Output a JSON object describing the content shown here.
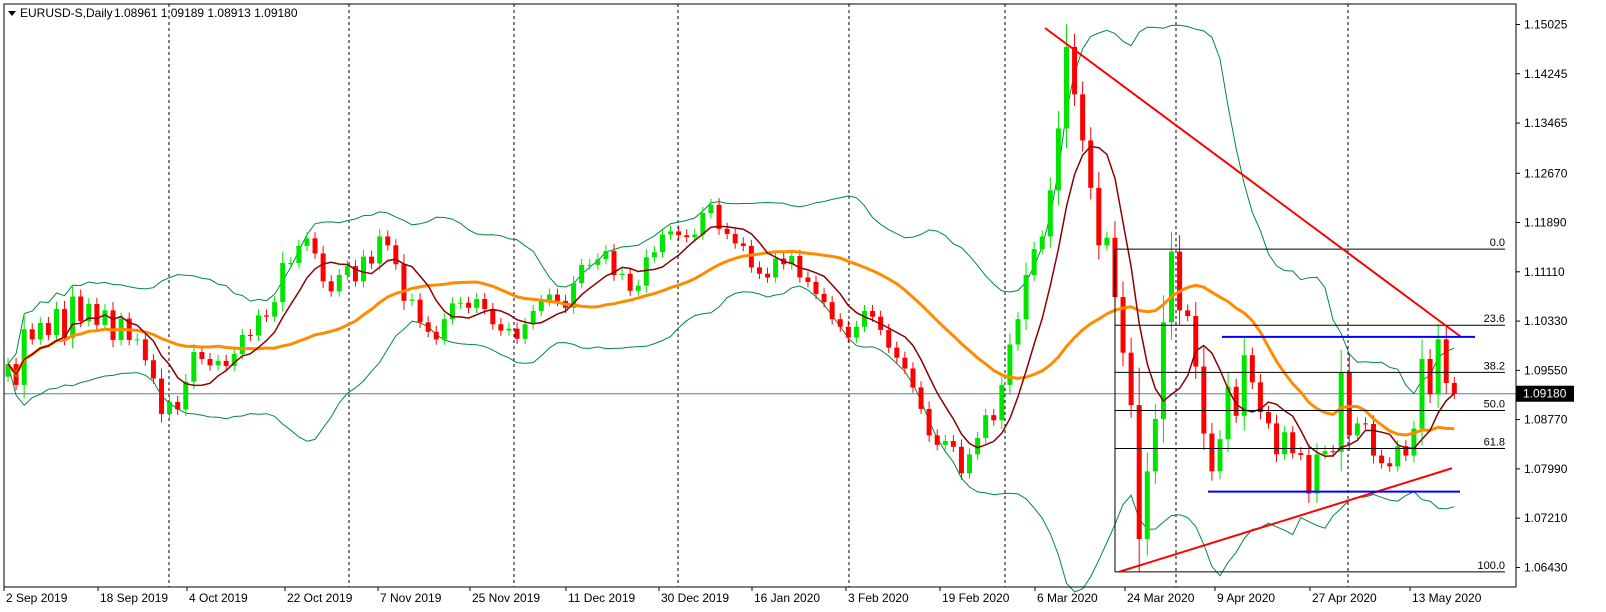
{
  "header": {
    "symbol": "EURUSD-S,Daily",
    "ohlc": "1.08961 1.09189 1.08913 1.09180"
  },
  "colors": {
    "background": "#ffffff",
    "bull": "#00e400",
    "bear": "#ff0000",
    "ma_fast": "#8b0000",
    "ma_slow": "#ff8c00",
    "bollinger": "#008a3e",
    "trendline": "#ff0000",
    "range_lines": "#0000ff",
    "fib_lines": "#000000",
    "price_line": "#4682b4",
    "current_price_bg": "#000000"
  },
  "chart_data": {
    "type": "candlestick",
    "symbol": "EURUSD-S",
    "timeframe": "Daily",
    "ylim": [
      1.0612,
      1.1535
    ],
    "y_ticks": [
      "1.15025",
      "1.14245",
      "1.13465",
      "1.12670",
      "1.11890",
      "1.11110",
      "1.10330",
      "1.09550",
      "1.08770",
      "1.07990",
      "1.07210",
      "1.06430"
    ],
    "x_ticks": [
      "2 Sep 2019",
      "18 Sep 2019",
      "4 Oct 2019",
      "22 Oct 2019",
      "7 Nov 2019",
      "25 Nov 2019",
      "11 Dec 2019",
      "30 Dec 2019",
      "16 Jan 2020",
      "3 Feb 2020",
      "19 Feb 2020",
      "6 Mar 2020",
      "24 Mar 2020",
      "9 Apr 2020",
      "27 Apr 2020",
      "13 May 2020"
    ],
    "current_price": "1.09180",
    "closes": [
      1.0965,
      1.0932,
      1.102,
      1.1004,
      1.103,
      1.1011,
      1.1052,
      1.1006,
      1.1072,
      1.1033,
      1.106,
      1.1027,
      1.105,
      1.1003,
      1.1037,
      1.1003,
      1.1004,
      1.0971,
      1.0942,
      1.0886,
      1.0905,
      1.0893,
      1.0937,
      1.0984,
      1.0973,
      1.0963,
      1.097,
      1.0962,
      1.0981,
      1.1011,
      1.101,
      1.1042,
      1.104,
      1.1063,
      1.1125,
      1.1125,
      1.1152,
      1.1164,
      1.114,
      1.1096,
      1.108,
      1.1106,
      1.112,
      1.1096,
      1.1135,
      1.1124,
      1.1167,
      1.1153,
      1.1123,
      1.1065,
      1.1067,
      1.1031,
      1.1016,
      1.1004,
      1.1036,
      1.1061,
      1.1062,
      1.1054,
      1.1068,
      1.1052,
      1.1028,
      1.1018,
      1.1021,
      1.1005,
      1.1028,
      1.1049,
      1.1065,
      1.1075,
      1.1065,
      1.1054,
      1.1093,
      1.1122,
      1.1122,
      1.1131,
      1.1144,
      1.1106,
      1.1108,
      1.1081,
      1.1089,
      1.1134,
      1.1142,
      1.117,
      1.1175,
      1.1169,
      1.1166,
      1.117,
      1.1204,
      1.1217,
      1.1179,
      1.1171,
      1.1156,
      1.1152,
      1.1118,
      1.1108,
      1.1102,
      1.1132,
      1.1123,
      1.1136,
      1.1102,
      1.1095,
      1.1076,
      1.1063,
      1.1036,
      1.1024,
      1.1007,
      1.1024,
      1.1049,
      1.104,
      1.1019,
      1.0991,
      1.0975,
      1.0958,
      1.0928,
      1.0894,
      1.0852,
      1.0837,
      1.0843,
      1.0834,
      1.0792,
      1.0822,
      1.0848,
      1.0884,
      1.0876,
      1.0932,
      1.0996,
      1.1036,
      1.1106,
      1.1147,
      1.1167,
      1.124,
      1.1338,
      1.1467,
      1.1392,
      1.1319,
      1.1244,
      1.1153,
      1.1165,
      1.1071,
      1.0983,
      1.09,
      1.0688,
      1.0795,
      1.0878,
      1.1031,
      1.1143,
      1.105,
      1.1041,
      1.0961,
      1.0855,
      1.0795,
      1.0846,
      1.0929,
      1.0883,
      1.0979,
      1.0936,
      1.0889,
      1.0871,
      1.0822,
      1.0857,
      1.0824,
      1.0821,
      1.076,
      1.0822,
      1.0827,
      1.0826,
      1.0952,
      1.0852,
      1.0871,
      1.087,
      1.082,
      1.0808,
      1.0803,
      1.0835,
      1.082,
      1.0863,
      1.0973,
      1.0917,
      1.1004,
      1.0935,
      1.0918
    ],
    "fibonacci": {
      "levels": [
        "0.0",
        "23.6",
        "38.2",
        "50.0",
        "61.8",
        "100.0"
      ],
      "high": 1.1147,
      "low": 1.0636
    },
    "indicators": [
      "Moving average (fast)",
      "Moving average (slow)",
      "Bollinger Bands"
    ],
    "drawings": [
      "Trendline from 1.1497 (6 Mar 2020) to 1.1008 (19 May 2020)",
      "Trendline from 1.0636 (23 Mar 2020) to 1.0800 (18 May 2020)",
      "Horizontal range 1.1008 – 1.0763"
    ]
  }
}
